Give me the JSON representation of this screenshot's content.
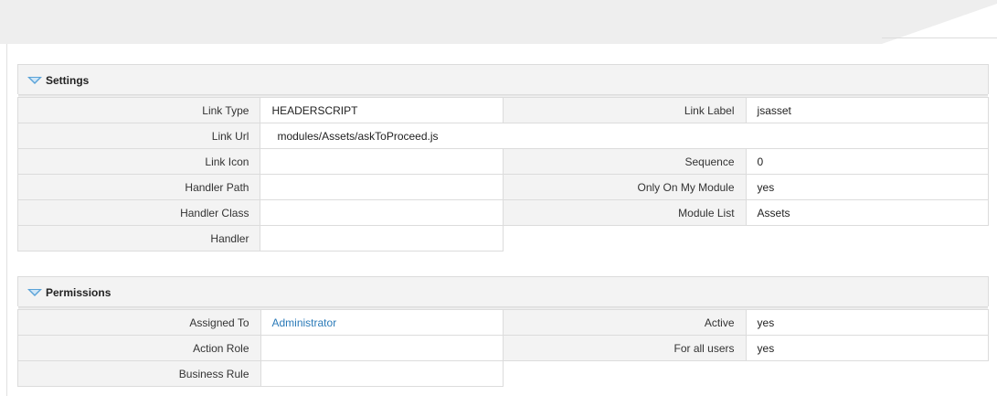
{
  "settings": {
    "title": "Settings",
    "link_type_label": "Link Type",
    "link_type_value": "HEADERSCRIPT",
    "link_label_label": "Link Label",
    "link_label_value": "jsasset",
    "link_url_label": "Link Url",
    "link_url_value": "modules/Assets/askToProceed.js",
    "link_icon_label": "Link Icon",
    "link_icon_value": "",
    "sequence_label": "Sequence",
    "sequence_value": "0",
    "handler_path_label": "Handler Path",
    "handler_path_value": "",
    "only_on_my_module_label": "Only On My Module",
    "only_on_my_module_value": "yes",
    "handler_class_label": "Handler Class",
    "handler_class_value": "",
    "module_list_label": "Module List",
    "module_list_value": "Assets",
    "handler_label": "Handler",
    "handler_value": ""
  },
  "permissions": {
    "title": "Permissions",
    "assigned_to_label": "Assigned To",
    "assigned_to_value": "Administrator",
    "active_label": "Active",
    "active_value": "yes",
    "action_role_label": "Action Role",
    "action_role_value": "",
    "for_all_users_label": "For all users",
    "for_all_users_value": "yes",
    "business_rule_label": "Business Rule",
    "business_rule_value": ""
  },
  "colors": {
    "link": "#2a7ab8",
    "toggle_icon": "#5aa3d8",
    "label_background": "#f3f3f3",
    "border": "#dcdcdc"
  }
}
